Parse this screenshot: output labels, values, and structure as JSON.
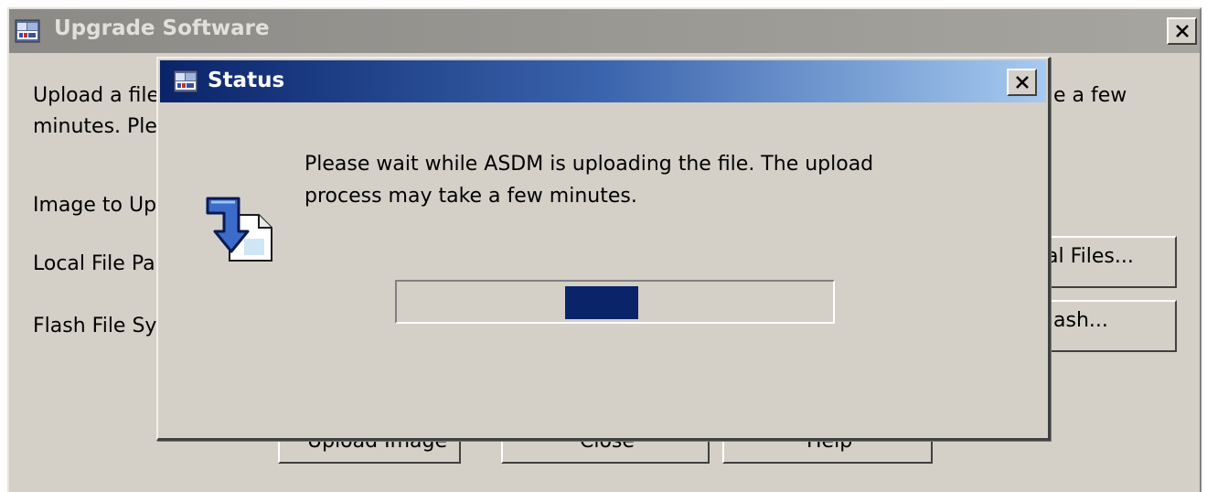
{
  "parent_window": {
    "title": "Upgrade Software",
    "intro_line1_visible": "Upload a file",
    "intro_line1_right": "e a few",
    "intro_line2_visible": "minutes. Ple",
    "image_label": "Image to Up",
    "local_file_label": "Local File Pa",
    "flash_file_label": "Flash File Sy",
    "browse_local_label": "al Files...",
    "browse_flash_label": "ash...",
    "upload_button_label": "Upload Image",
    "close_button_label": "Close",
    "help_button_label": "Help"
  },
  "status_dialog": {
    "title": "Status",
    "message_line1": "Please wait while ASDM is uploading the file. The upload",
    "message_line2": "process may take a few minutes.",
    "progress_indicator": "indeterminate",
    "progress_block_offset_fraction": 0.44
  },
  "icons": {
    "app": "asdm-app-icon",
    "close": "close-icon",
    "upload": "upload-file-icon"
  },
  "colors": {
    "active_title_start": "#0a246a",
    "active_title_end": "#a6caf0",
    "inactive_title": "#8c8a86",
    "window_bg": "#d4d0c8",
    "progress_fill": "#0a246a"
  }
}
